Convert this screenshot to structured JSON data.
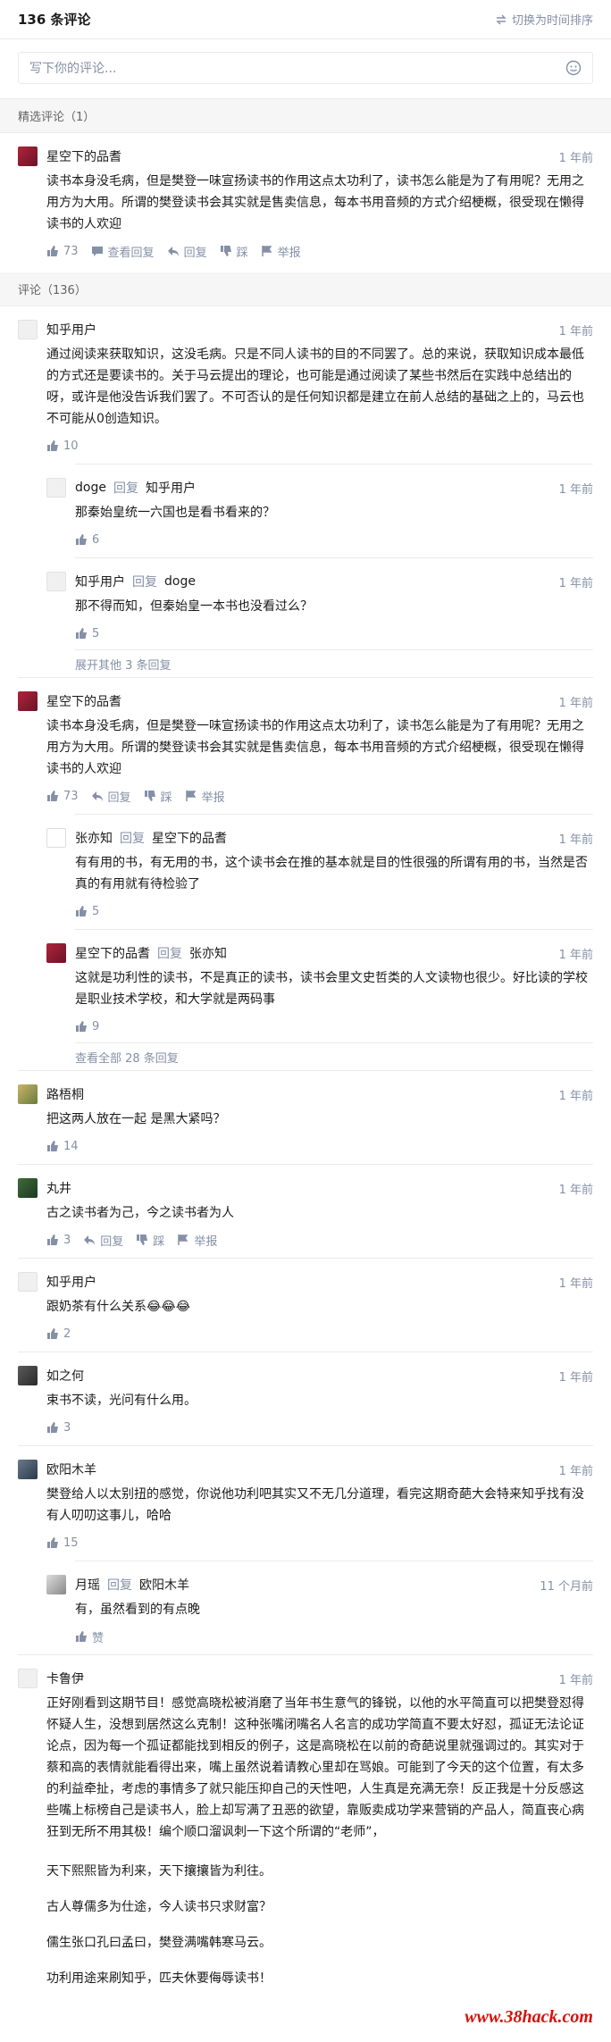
{
  "header": {
    "count": "136 条评论",
    "switch_label": "切换为时间排序"
  },
  "editor": {
    "placeholder": "写下你的评论..."
  },
  "featured_head": "精选评论（1）",
  "all_head": "评论（136）",
  "featured": {
    "name": "星空下的品耆",
    "time": "1 年前",
    "text": "读书本身没毛病，但是樊登一味宣扬读书的作用这点太功利了，读书怎么能是为了有用呢？无用之用方为大用。所谓的樊登读书会其实就是售卖信息，每本书用音频的方式介绍梗概，很受现在懒得读书的人欢迎",
    "likes": "73",
    "view_replies": "查看回复",
    "reply": "回复",
    "dislike": "踩",
    "report": "举报"
  },
  "comments": [
    {
      "name": "知乎用户",
      "time": "1 年前",
      "text": "通过阅读来获取知识，这没毛病。只是不同人读书的目的不同罢了。总的来说，获取知识成本最低的方式还是要读书的。关于马云提出的理论，也可能是通过阅读了某些书然后在实践中总结出的呀，或许是他没告诉我们罢了。不可否认的是任何知识都是建立在前人总结的基础之上的，马云也不可能从0创造知识。",
      "likes": "10",
      "replies": [
        {
          "name": "doge",
          "reply_word": "回复",
          "to": "知乎用户",
          "time": "1 年前",
          "text": "那秦始皇统一六国也是看书看来的？",
          "likes": "6"
        },
        {
          "name": "知乎用户",
          "reply_word": "回复",
          "to": "doge",
          "time": "1 年前",
          "text": "那不得而知，但秦始皇一本书也没看过么？",
          "likes": "5"
        }
      ],
      "more": "展开其他 3 条回复"
    },
    {
      "name": "星空下的品耆",
      "time": "1 年前",
      "text": "读书本身没毛病，但是樊登一味宣扬读书的作用这点太功利了，读书怎么能是为了有用呢？无用之用方为大用。所谓的樊登读书会其实就是售卖信息，每本书用音频的方式介绍梗概，很受现在懒得读书的人欢迎",
      "likes": "73",
      "reply": "回复",
      "dislike": "踩",
      "report": "举报",
      "replies": [
        {
          "name": "张亦知",
          "reply_word": "回复",
          "to": "星空下的品耆",
          "time": "1 年前",
          "text": "有有用的书，有无用的书，这个读书会在推的基本就是目的性很强的所谓有用的书，当然是否真的有用就有待检验了",
          "likes": "5"
        },
        {
          "name": "星空下的品耆",
          "reply_word": "回复",
          "to": "张亦知",
          "time": "1 年前",
          "text": "这就是功利性的读书，不是真正的读书，读书会里文史哲类的人文读物也很少。好比读的学校是职业技术学校，和大学就是两码事",
          "likes": "9"
        }
      ],
      "more": "查看全部 28 条回复"
    },
    {
      "name": "路梧桐",
      "time": "1 年前",
      "text": "把这两人放在一起 是黑大紧吗？",
      "likes": "14"
    },
    {
      "name": "丸井",
      "time": "1 年前",
      "text": "古之读书者为己，今之读书者为人",
      "likes": "3",
      "reply": "回复",
      "dislike": "踩",
      "report": "举报"
    },
    {
      "name": "知乎用户",
      "time": "1 年前",
      "text": "跟奶茶有什么关系😂😂😂",
      "likes": "2"
    },
    {
      "name": "如之何",
      "time": "1 年前",
      "text": "束书不读，光问有什么用。",
      "likes": "3"
    },
    {
      "name": "欧阳木羊",
      "time": "1 年前",
      "text": "樊登给人以太别扭的感觉，你说他功利吧其实又不无几分道理，看完这期奇葩大会特来知乎找有没有人叨叨这事儿，哈哈",
      "likes": "15",
      "replies": [
        {
          "name": "月瑶",
          "reply_word": "回复",
          "to": "欧阳木羊",
          "time": "11 个月前",
          "text": "有，虽然看到的有点晚",
          "likes": "赞"
        }
      ]
    },
    {
      "name": "卡鲁伊",
      "time": "1 年前",
      "text": "正好刚看到这期节目！感觉高晓松被消磨了当年书生意气的锋锐，以他的水平简直可以把樊登怼得怀疑人生，没想到居然这么克制！这种张嘴闭嘴名人名言的成功学简直不要太好怼，孤证无法论证论点，因为每一个孤证都能找到相反的例子，这是高晓松在以前的奇葩说里就强调过的。其实对于蔡和高的表情就能看得出来，嘴上虽然说着请教心里却在骂娘。可能到了今天的这个位置，有太多的利益牵扯，考虑的事情多了就只能压抑自己的天性吧，人生真是充满无奈！反正我是十分反感这些嘴上标榜自己是读书人，脸上却写满了丑恶的欲望，靠贩卖成功学来营销的产品人，简直丧心病狂到无所不用其极！编个顺口溜讽刺一下这个所谓的“老师”，",
      "paras": [
        "天下熙熙皆为利来，天下攘攘皆为利往。",
        "古人尊儒多为仕途，今人读书只求财富？",
        "儒生张口孔曰孟曰，樊登满嘴韩寒马云。",
        "功利用途来刷知乎，匹夫休要侮辱读书！"
      ]
    }
  ],
  "watermark": "www.38hack.com"
}
